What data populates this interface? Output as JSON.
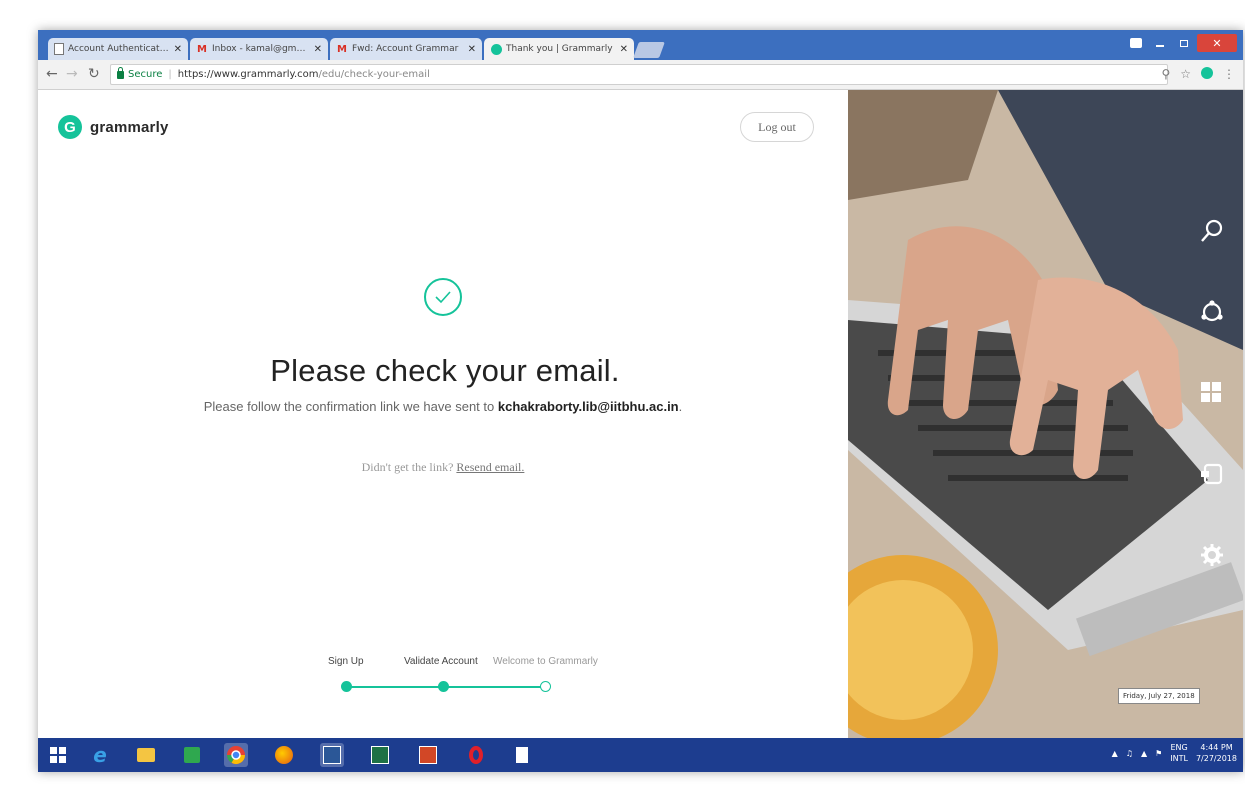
{
  "browser": {
    "tabs": [
      {
        "label": "Account Authentication fo",
        "icon": "document-icon",
        "active": false
      },
      {
        "label": "Inbox - kamal@gmail.",
        "icon": "gmail-icon",
        "active": false
      },
      {
        "label": "Fwd: Account Grammar",
        "icon": "gmail-icon",
        "active": false
      },
      {
        "label": "Thank you | Grammarly",
        "icon": "grammarly-icon",
        "active": true
      }
    ],
    "close_glyph": "✕",
    "secure_label": "Secure",
    "url_host": "https://www.grammarly.com",
    "url_path": "/edu/check-your-email"
  },
  "page": {
    "brand": "grammarly",
    "logo_letter": "G",
    "logout_label": "Log out",
    "heading": "Please check your email.",
    "subline_prefix": "Please follow the confirmation link we have sent to",
    "email": "kchakraborty.lib@iitbhu.ac.in",
    "subline_suffix": ".",
    "resend_prefix": "Didn't get the link?",
    "resend_link": "Resend email.",
    "steps": {
      "labels": [
        "Sign Up",
        "Validate Account",
        "Welcome to Grammarly"
      ],
      "completed": 2,
      "total": 3
    }
  },
  "charms": [
    "search-icon",
    "share-icon",
    "windows-start-icon",
    "devices-icon",
    "settings-icon"
  ],
  "taskbar": {
    "apps": [
      "windows-start-icon",
      "internet-explorer-icon",
      "file-explorer-icon",
      "store-icon",
      "chrome-icon",
      "firefox-icon",
      "word-icon",
      "excel-icon",
      "powerpoint-icon",
      "opera-icon",
      "document-icon"
    ],
    "lang_top": "ENG",
    "lang_bottom": "INTL",
    "time": "4:44 PM",
    "date": "7/27/2018",
    "tooltip": "Friday, July 27, 2018"
  },
  "colors": {
    "accent": "#15c39a",
    "tabstrip": "#3c6fbf",
    "taskbar": "#1d3d8f"
  }
}
